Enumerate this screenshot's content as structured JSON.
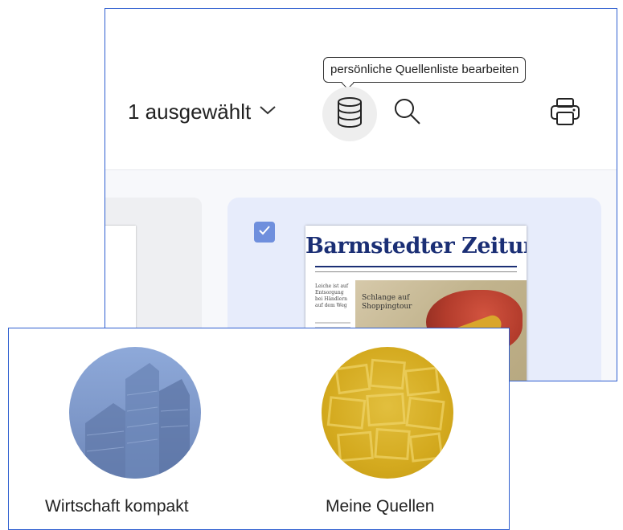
{
  "toolbar": {
    "selection_label": "1 ausgewählt",
    "tooltip": "persönliche Quellenliste bearbeiten",
    "icons": {
      "chevron": "chevron-down-icon",
      "database": "database-icon",
      "search": "search-icon",
      "print": "print-icon",
      "checkbox": "checkmark-icon"
    }
  },
  "results": {
    "selected_card": {
      "checked": true,
      "newspaper_title": "Barmstedter Zeitung",
      "headline": "Schlange auf Shoppingtour",
      "side_text": "Leiche ist auf Entsorgung bei Händlern auf dem Weg"
    }
  },
  "tiles": [
    {
      "label": "Wirtschaft kompakt",
      "image": "skyscrapers"
    },
    {
      "label": "Meine Quellen",
      "image": "bookshelf"
    }
  ],
  "colors": {
    "accent_blue": "#2f5fd0",
    "checkbox_blue": "#6f8fdd",
    "selected_card_bg": "#e7ecfb",
    "newspaper_blue": "#1b2f75",
    "quellen_yellow": "#d4aa1f",
    "wirtschaft_blue": "#7e98c9"
  }
}
